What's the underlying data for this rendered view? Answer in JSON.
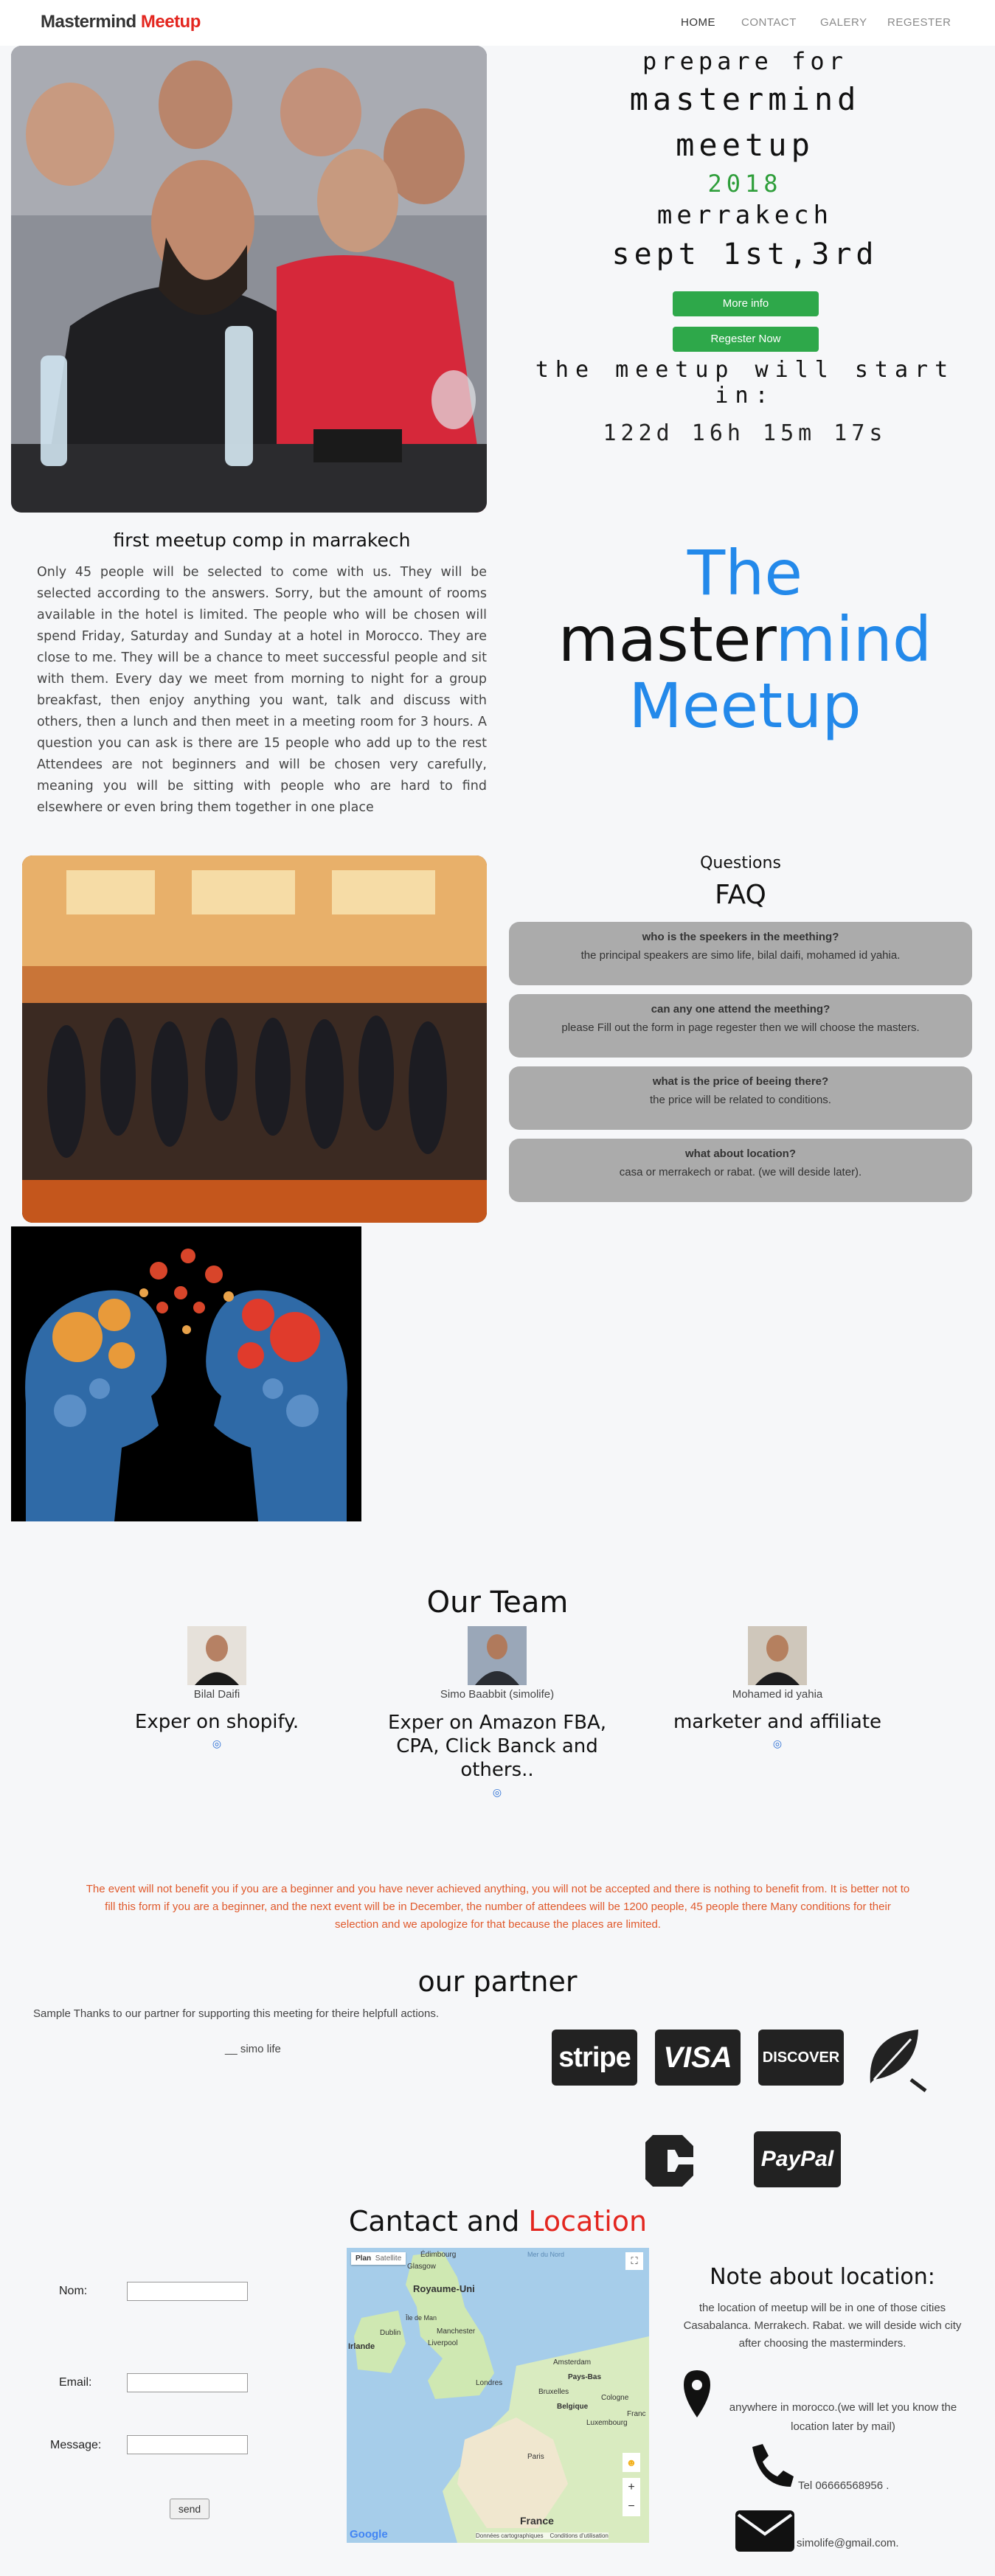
{
  "nav": {
    "brand_part1": "Mastermind",
    "brand_part2": "Meetup",
    "links": [
      "HOME",
      "CONTACT",
      "GALERY",
      "REGESTER"
    ]
  },
  "hero": {
    "line1": "prepare for",
    "line2": "mastermind",
    "line3": "meetup",
    "year": "2018",
    "city": "merrakech",
    "dates": "sept 1st,3rd",
    "more_info": "More info",
    "register_now": "Regester Now",
    "countdown_label": "the meetup will start in:",
    "countdown": "122d 16h 15m 17s"
  },
  "intro": {
    "heading": "first meetup comp in marrakech",
    "body": "Only 45 people will be selected to come with us. They will be selected according to the answers. Sorry, but the amount of rooms available in the hotel is limited. The people who will be chosen will spend Friday, Saturday and Sunday at a hotel in Morocco. They are close to me. They will be a chance to meet successful people and sit with them. Every day we meet from morning to night for a group breakfast, then enjoy anything you want, talk and discuss with others, then a lunch and then meet in a meeting room for 3 hours. A question you can ask is there are 15 people who add up to the rest Attendees are not beginners and will be chosen very carefully, meaning you will be sitting with people who are hard to find elsewhere or even bring them together in one place"
  },
  "big_title": {
    "w1": "The",
    "w2a": "master",
    "w2b": "mind",
    "w3": "Meetup"
  },
  "faq": {
    "pre": "Questions",
    "title": "FAQ",
    "items": [
      {
        "q": "who is the speekers in the meething?",
        "a": "the principal speakers are simo life, bilal daifi, mohamed id yahia."
      },
      {
        "q": "can any one attend the meething?",
        "a": "please Fill out the form in page regester then we will choose the masters."
      },
      {
        "q": "what is the price of beeing there?",
        "a": "the price will be related to conditions."
      },
      {
        "q": "what about location?",
        "a": "casa or merrakech or rabat. (we will deside later)."
      }
    ]
  },
  "team": {
    "title": "Our Team",
    "members": [
      {
        "name": "Bilal Daifi",
        "role": "Exper on shopify."
      },
      {
        "name": "Simo Baabbit (simolife)",
        "role": "Exper on Amazon FBA, CPA, Click Banck and others.."
      },
      {
        "name": "Mohamed id yahia",
        "role": "marketer and affiliate"
      }
    ]
  },
  "notice": "The event will not benefit you if you are a beginner and you have never achieved anything, you will not be accepted and there is nothing to benefit from. It is better not to fill this form if you are a beginner, and the next event will be in December, the number of attendees will be 1200 people, 45 people there Many conditions for their selection and we apologize for that because the places are limited.",
  "partner": {
    "title": "our partner",
    "thanks": "Sample Thanks to our partner for supporting this meeting for theire helpfull actions.",
    "sign": "__ simo life",
    "logos": [
      "stripe",
      "VISA",
      "DISCOVER",
      "PayPal"
    ]
  },
  "contact": {
    "title_a": "Cantact and",
    "title_b": "Location",
    "nom": "Nom:",
    "email": "Email:",
    "message": "Message:",
    "send": "send"
  },
  "map": {
    "plan": "Plan",
    "satellite": "Satellite",
    "places": [
      "Royaume-Uni",
      "Mer du Nord",
      "Édimbourg",
      "Glasgow",
      "Île de Man",
      "Dublin",
      "Irlande",
      "Manchester",
      "Liverpool",
      "Londres",
      "Amsterdam",
      "Pays-Bas",
      "Bruxelles",
      "Belgique",
      "Cologne",
      "Luxembourg",
      "Paris",
      "France",
      "Franc"
    ],
    "footer": "Données cartographiques    Conditions d'utilisation",
    "google": "Google"
  },
  "location_note": {
    "title": "Note about location:",
    "body": "the location of meetup will be in one of those cities Casabalanca. Merrakech. Rabat. we will deside wich city after choosing the masterminders.",
    "where": "anywhere in morocco.(we will let you know the location later by mail)",
    "tel": "Tel 06666568956 .",
    "mail": "simolife@gmail.com."
  }
}
